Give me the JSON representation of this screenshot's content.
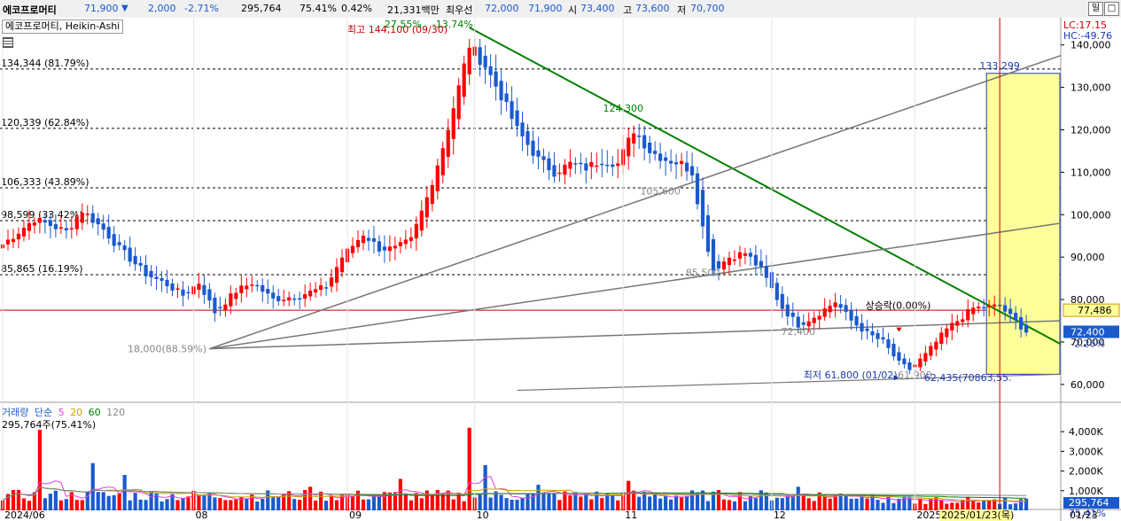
{
  "header": {
    "name": "에코프로머티",
    "price": "71,900",
    "change": "2,000",
    "change_pct": "-2.71%",
    "volume": "295,764",
    "volume_ratio": "75.41%",
    "turnover": "0.42%",
    "amount": "21,331백만",
    "best_bid_label": "최우선",
    "ask": "72,000",
    "bid": "71,900",
    "open_label": "시",
    "open": "73,400",
    "high_label": "고",
    "high": "73,600",
    "low_label": "저",
    "low": "70,700",
    "period_button": "일",
    "restore_button": "□"
  },
  "colors": {
    "up": "#ff0000",
    "down": "#1a5acd",
    "trend": "#008000",
    "fib": "#000000",
    "highlight": "#ffff99",
    "ma": "#b0b000"
  },
  "chart_data": [
    {
      "type": "candlestick",
      "title": "에코프로머티, Heikin-Ashi",
      "ylim": [
        56000,
        146000
      ],
      "y_ticks": [
        60000,
        70000,
        80000,
        90000,
        100000,
        110000,
        120000,
        130000,
        140000
      ],
      "y_tick_labels": [
        "60,000",
        "70,000",
        "80,000",
        "90,000",
        "100,000",
        "110,000",
        "120,000",
        "130,000",
        "140,000"
      ],
      "x_labels": [
        "2024/06",
        "08",
        "09",
        "10",
        "11",
        "12",
        "2025/01",
        "2025/01/23(목)",
        "01/23"
      ],
      "x_label_index": [
        0,
        36,
        65,
        89,
        117,
        145,
        172,
        188,
        199
      ],
      "anchors": [
        [
          0,
          93000
        ],
        [
          6,
          99000
        ],
        [
          9,
          97500
        ],
        [
          12,
          96000
        ],
        [
          15,
          101000
        ],
        [
          19,
          96500
        ],
        [
          22,
          92000
        ],
        [
          27,
          86000
        ],
        [
          31,
          83500
        ],
        [
          34,
          81000
        ],
        [
          37,
          84000
        ],
        [
          40,
          77000
        ],
        [
          44,
          82000
        ],
        [
          47,
          84000
        ],
        [
          51,
          80000
        ],
        [
          56,
          81000
        ],
        [
          61,
          83000
        ],
        [
          64,
          90000
        ],
        [
          68,
          95500
        ],
        [
          71,
          92000
        ],
        [
          74,
          92000
        ],
        [
          77,
          94000
        ],
        [
          80,
          104000
        ],
        [
          83,
          116000
        ],
        [
          86,
          130000
        ],
        [
          88,
          140000
        ],
        [
          91,
          135000
        ],
        [
          94,
          128000
        ],
        [
          97,
          120000
        ],
        [
          101,
          113000
        ],
        [
          104,
          110000
        ],
        [
          107,
          112000
        ],
        [
          110,
          111000
        ],
        [
          113,
          113000
        ],
        [
          116,
          112000
        ],
        [
          119,
          120000
        ],
        [
          122,
          115000
        ],
        [
          125,
          113000
        ],
        [
          128,
          112000
        ],
        [
          130,
          110000
        ],
        [
          132,
          97000
        ],
        [
          134,
          87000
        ],
        [
          137,
          90000
        ],
        [
          140,
          91000
        ],
        [
          143,
          87000
        ],
        [
          147,
          78000
        ],
        [
          150,
          74000
        ],
        [
          153,
          76000
        ],
        [
          157,
          79500
        ],
        [
          160,
          75000
        ],
        [
          163,
          72000
        ],
        [
          166,
          70000
        ],
        [
          169,
          65000
        ],
        [
          171,
          63500
        ],
        [
          174,
          67000
        ],
        [
          178,
          73000
        ],
        [
          183,
          78000
        ],
        [
          188,
          78500
        ],
        [
          190,
          76000
        ],
        [
          193,
          72400
        ]
      ],
      "max_label": "최고 144,100 (09/30)",
      "max_pct": "27.55%",
      "max_pct2": "-13.74%",
      "min_label": "최저 61,800 (01/02)",
      "current_label": "72,400",
      "current_pct": "-2.26%",
      "lc_label": "LC:17.15",
      "hc_label": "HC:-49.76",
      "ref_price_label": "77,486",
      "fib_levels": [
        {
          "value": 134344,
          "label": "134,344 (81.79%)"
        },
        {
          "value": 120339,
          "label": "120,339 (62.84%)"
        },
        {
          "value": 106333,
          "label": "106,333 (43.89%)"
        },
        {
          "value": 98599,
          "label": "98,599 (33.42%)"
        },
        {
          "value": 85865,
          "label": "85,865 (16.19%)"
        }
      ],
      "point_labels": [
        {
          "text": "124,300",
          "x": 117,
          "y": 124300,
          "color": "#008000"
        },
        {
          "text": "105,600",
          "x": 124,
          "y": 104800,
          "color": "#888888"
        },
        {
          "text": "85,500",
          "x": 132,
          "y": 85500,
          "color": "#888888"
        },
        {
          "text": "72,400",
          "x": 150,
          "y": 71700,
          "color": "#888888"
        },
        {
          "text": "61,900",
          "x": 172,
          "y": 61400,
          "color": "#888888"
        },
        {
          "text": "133,299",
          "x": 188,
          "y": 134300,
          "color": "#1a3ab0"
        },
        {
          "text": "62,435(70863,55.",
          "x": 182,
          "y": 60800,
          "color": "#1a3ab0"
        }
      ],
      "left_stub_label": "18,000(88.59%)",
      "rise_label": "상승락(0.00%)"
    },
    {
      "type": "bar",
      "legend": [
        "거래량",
        "단순",
        "5",
        "20",
        "60",
        "120"
      ],
      "legend_colors": [
        "#1a5acd",
        "#1a5acd",
        "#e040e0",
        "#d0a000",
        "#008000",
        "#888888"
      ],
      "ylabel": "295,764주(75.41%)",
      "ylim": [
        0,
        5000000
      ],
      "y_ticks": [
        1000000,
        2000000,
        3000000,
        4000000
      ],
      "y_tick_labels": [
        "1,000K",
        "2,000K",
        "3,000K",
        "4,000K"
      ],
      "current_volume_label": "295,764",
      "current_volume_pct": "75.41%",
      "spikes": [
        [
          7,
          4100000
        ],
        [
          17,
          2400000
        ],
        [
          23,
          1800000
        ],
        [
          58,
          1200000
        ],
        [
          75,
          1600000
        ],
        [
          88,
          4200000
        ],
        [
          91,
          2300000
        ],
        [
          101,
          1300000
        ],
        [
          118,
          1500000
        ],
        [
          150,
          1200000
        ],
        [
          173,
          1300000
        ]
      ]
    }
  ]
}
